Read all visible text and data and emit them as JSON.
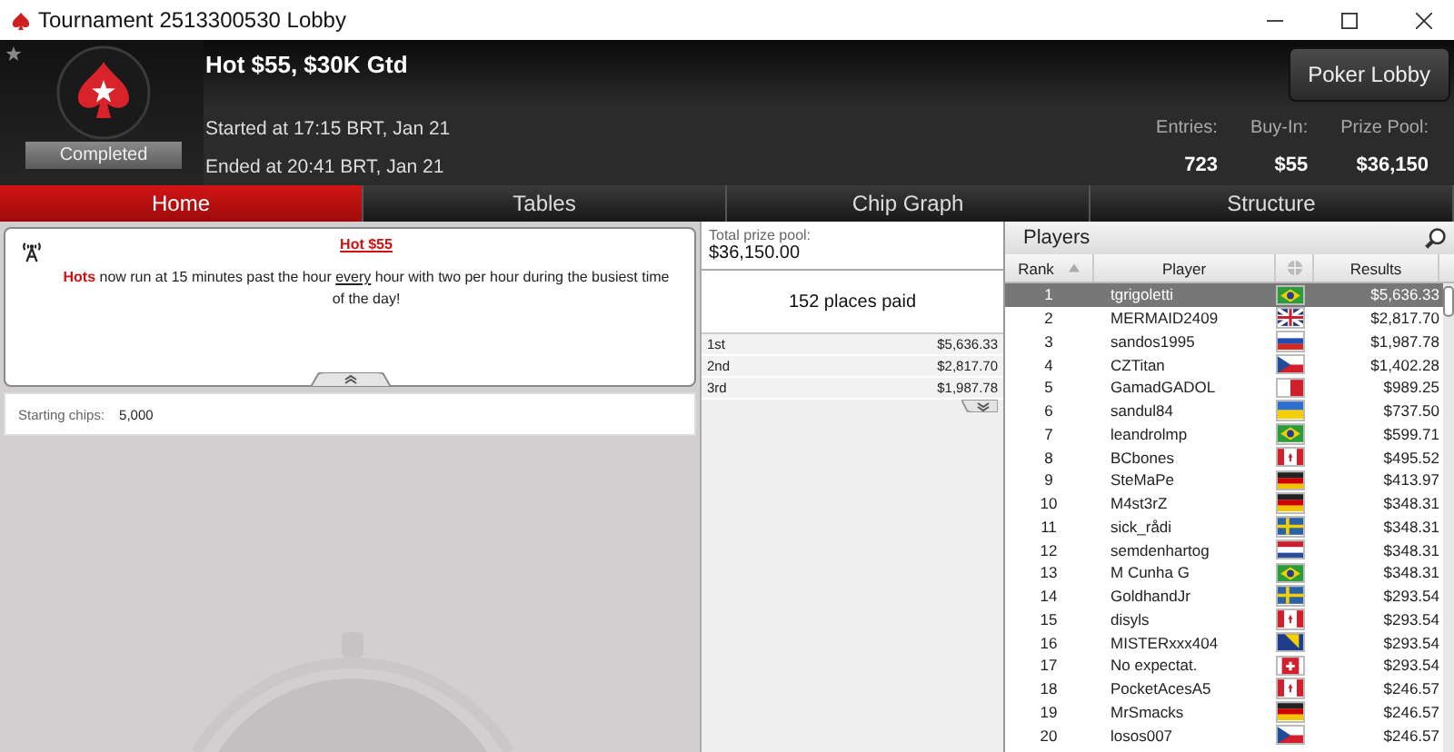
{
  "window": {
    "title": "Tournament 2513300530 Lobby"
  },
  "header": {
    "title": "Hot $55, $30K Gtd",
    "status": "Completed",
    "started": "Started at 17:15 BRT, Jan 21",
    "ended": "Ended at 20:41 BRT, Jan 21",
    "lobby_button": "Poker Lobby",
    "stats": [
      {
        "label": "Entries:",
        "value": "723"
      },
      {
        "label": "Buy-In:",
        "value": "$55"
      },
      {
        "label": "Prize Pool:",
        "value": "$36,150"
      }
    ]
  },
  "tabs": [
    {
      "label": "Home",
      "selected": true
    },
    {
      "label": "Tables",
      "selected": false
    },
    {
      "label": "Chip Graph",
      "selected": false
    },
    {
      "label": "Structure",
      "selected": false
    }
  ],
  "announcement": {
    "title": "Hot $55",
    "text": "**Hots** now run at 15 minutes past the hour *every* hour with two per hour during the busiest time of the day!"
  },
  "starting_chips": {
    "label": "Starting chips:",
    "value": "5,000"
  },
  "prizes": {
    "label": "Total prize pool:",
    "total": "$36,150.00",
    "places": "152 places paid",
    "payouts": [
      {
        "place": "1st",
        "amount": "$5,636.33"
      },
      {
        "place": "2nd",
        "amount": "$2,817.70"
      },
      {
        "place": "3rd",
        "amount": "$1,987.78"
      }
    ]
  },
  "players": {
    "title": "Players",
    "columns": [
      "Rank",
      "Player",
      "Results"
    ],
    "rows": [
      {
        "rank": "1",
        "name": "tgrigoletti",
        "flag": {
          "kind": "brazil"
        },
        "result": "$5,636.33",
        "selected": true
      },
      {
        "rank": "2",
        "name": "MERMAID2409",
        "flag": {
          "kind": "uk"
        },
        "result": "$2,817.70",
        "selected": false
      },
      {
        "rank": "3",
        "name": "sandos1995",
        "flag": {
          "kind": "russia"
        },
        "result": "$1,987.78",
        "selected": false
      },
      {
        "rank": "4",
        "name": "CZTitan",
        "flag": {
          "kind": "czech"
        },
        "result": "$1,402.28",
        "selected": false
      },
      {
        "rank": "5",
        "name": "GamadGADOL",
        "flag": {
          "kind": "malta"
        },
        "result": "$989.25",
        "selected": false
      },
      {
        "rank": "6",
        "name": "sandul84",
        "flag": {
          "kind": "ukraine"
        },
        "result": "$737.50",
        "selected": false
      },
      {
        "rank": "7",
        "name": "leandrolmp",
        "flag": {
          "kind": "brazil"
        },
        "result": "$599.71",
        "selected": false
      },
      {
        "rank": "8",
        "name": "BCbones",
        "flag": {
          "kind": "canada"
        },
        "result": "$495.52",
        "selected": false
      },
      {
        "rank": "9",
        "name": "SteMaPe",
        "flag": {
          "kind": "germany"
        },
        "result": "$413.97",
        "selected": false
      },
      {
        "rank": "10",
        "name": "M4st3rZ",
        "flag": {
          "kind": "germany"
        },
        "result": "$348.31",
        "selected": false
      },
      {
        "rank": "11",
        "name": "sick_rådi",
        "flag": {
          "kind": "sweden"
        },
        "result": "$348.31",
        "selected": false
      },
      {
        "rank": "12",
        "name": "semdenhartog",
        "flag": {
          "kind": "netherlands"
        },
        "result": "$348.31",
        "selected": false
      },
      {
        "rank": "13",
        "name": "M Cunha G",
        "flag": {
          "kind": "brazil"
        },
        "result": "$348.31",
        "selected": false
      },
      {
        "rank": "14",
        "name": "GoldhandJr",
        "flag": {
          "kind": "sweden"
        },
        "result": "$293.54",
        "selected": false
      },
      {
        "rank": "15",
        "name": "disyls",
        "flag": {
          "kind": "canada"
        },
        "result": "$293.54",
        "selected": false
      },
      {
        "rank": "16",
        "name": "MISTERxxx404",
        "flag": {
          "kind": "bosnia"
        },
        "result": "$293.54",
        "selected": false
      },
      {
        "rank": "17",
        "name": "No expectat.",
        "flag": {
          "kind": "switzerland"
        },
        "result": "$293.54",
        "selected": false
      },
      {
        "rank": "18",
        "name": "PocketAcesA5",
        "flag": {
          "kind": "canada"
        },
        "result": "$246.57",
        "selected": false
      },
      {
        "rank": "19",
        "name": "MrSmacks",
        "flag": {
          "kind": "germany"
        },
        "result": "$246.57",
        "selected": false
      },
      {
        "rank": "20",
        "name": "losos007",
        "flag": {
          "kind": "czech"
        },
        "result": "$246.57",
        "selected": false
      }
    ]
  }
}
